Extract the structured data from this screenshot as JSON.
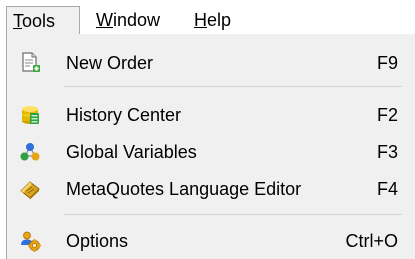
{
  "menubar": {
    "items": [
      {
        "label": "Tools",
        "mnemonic": "T",
        "rest": "ools",
        "active": true
      },
      {
        "label": "Window",
        "mnemonic": "W",
        "rest": "indow",
        "active": false
      },
      {
        "label": "Help",
        "mnemonic": "H",
        "rest": "elp",
        "active": false
      }
    ]
  },
  "dropdown": {
    "items": [
      {
        "label": "New Order",
        "shortcut": "F9",
        "icon": "new-order-icon"
      },
      {
        "label": "History Center",
        "shortcut": "F2",
        "icon": "history-center-icon"
      },
      {
        "label": "Global Variables",
        "shortcut": "F3",
        "icon": "global-variables-icon"
      },
      {
        "label": "MetaQuotes Language Editor",
        "shortcut": "F4",
        "icon": "metaeditor-icon"
      },
      {
        "label": "Options",
        "shortcut": "Ctrl+O",
        "icon": "options-icon"
      }
    ]
  }
}
